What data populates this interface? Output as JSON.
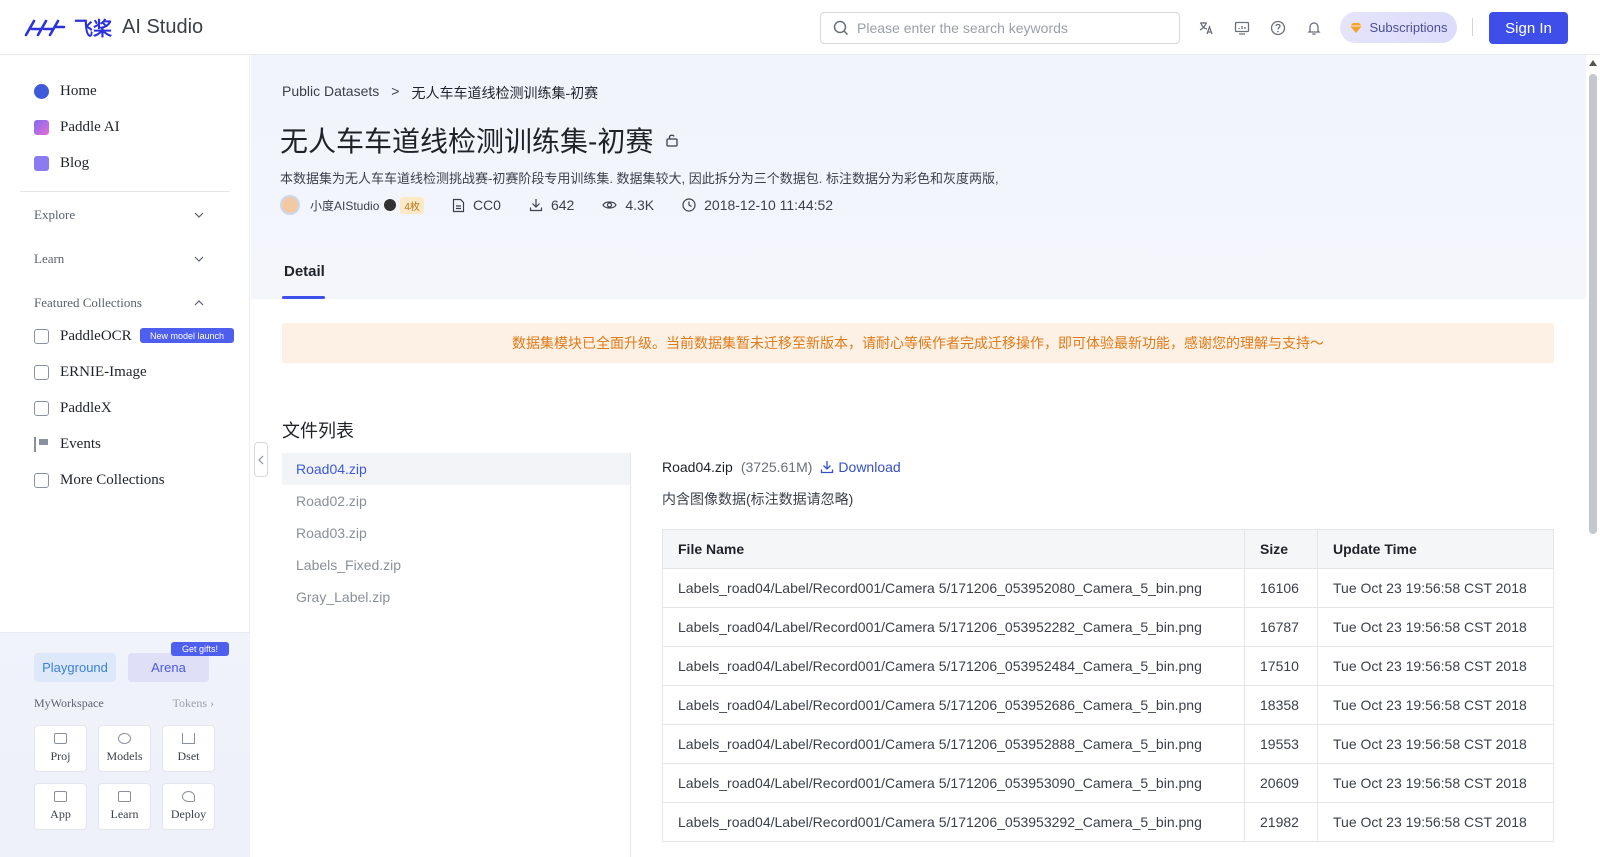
{
  "header": {
    "logo_cn": "飞桨",
    "logo_en": "AI Studio",
    "search_placeholder": "Please enter the search keywords",
    "subscriptions": "Subscriptions",
    "sign_in": "Sign In"
  },
  "sidebar": {
    "items": [
      {
        "label": "Home",
        "icon": "home-icon"
      },
      {
        "label": "Paddle AI",
        "icon": "paddle-ai-icon"
      },
      {
        "label": "Blog",
        "icon": "blog-icon"
      }
    ],
    "sections": [
      {
        "label": "Explore",
        "expanded": false
      },
      {
        "label": "Learn",
        "expanded": false
      },
      {
        "label": "Featured Collections",
        "expanded": true
      }
    ],
    "collections": [
      {
        "label": "PaddleOCR",
        "badge": "New model launch"
      },
      {
        "label": "ERNIE-Image"
      },
      {
        "label": "PaddleX"
      },
      {
        "label": "Events"
      },
      {
        "label": "More Collections"
      }
    ],
    "workspace": {
      "playground": "Playground",
      "arena": "Arena",
      "gift_badge": "Get gifts!",
      "title": "MyWorkspace",
      "tokens": "Tokens",
      "tiles": [
        "Proj",
        "Models",
        "Dset",
        "App",
        "Learn",
        "Deploy"
      ]
    }
  },
  "main": {
    "breadcrumb": {
      "parent": "Public Datasets",
      "sep": ">",
      "current": "无人车车道线检测训练集-初赛"
    },
    "title": "无人车车道线检测训练集-初赛",
    "description": "本数据集为无人车车道线检测挑战赛-初赛阶段专用训练集. 数据集较大, 因此拆分为三个数据包. 标注数据分为彩色和灰度两版,",
    "meta": {
      "author": "小度AIStudio",
      "badge": "4枚",
      "license": "CC0",
      "downloads": "642",
      "views": "4.3K",
      "date": "2018-12-10 11:44:52"
    },
    "tab": "Detail",
    "notice": "数据集模块已全面升级。当前数据集暂未迁移至新版本，请耐心等候作者完成迁移操作，即可体验最新功能，感谢您的理解与支持～",
    "file_list_title": "文件列表",
    "files": [
      "Road04.zip",
      "Road02.zip",
      "Road03.zip",
      "Labels_Fixed.zip",
      "Gray_Label.zip"
    ],
    "selected": {
      "name": "Road04.zip",
      "size": "(3725.61M)",
      "download": "Download",
      "desc": "内含图像数据(标注数据请忽略)"
    },
    "table": {
      "headers": [
        "File Name",
        "Size",
        "Update Time"
      ],
      "rows": [
        [
          "Labels_road04/Label/Record001/Camera 5/171206_053952080_Camera_5_bin.png",
          "16106",
          "Tue Oct 23 19:56:58 CST 2018"
        ],
        [
          "Labels_road04/Label/Record001/Camera 5/171206_053952282_Camera_5_bin.png",
          "16787",
          "Tue Oct 23 19:56:58 CST 2018"
        ],
        [
          "Labels_road04/Label/Record001/Camera 5/171206_053952484_Camera_5_bin.png",
          "17510",
          "Tue Oct 23 19:56:58 CST 2018"
        ],
        [
          "Labels_road04/Label/Record001/Camera 5/171206_053952686_Camera_5_bin.png",
          "18358",
          "Tue Oct 23 19:56:58 CST 2018"
        ],
        [
          "Labels_road04/Label/Record001/Camera 5/171206_053952888_Camera_5_bin.png",
          "19553",
          "Tue Oct 23 19:56:58 CST 2018"
        ],
        [
          "Labels_road04/Label/Record001/Camera 5/171206_053953090_Camera_5_bin.png",
          "20609",
          "Tue Oct 23 19:56:58 CST 2018"
        ],
        [
          "Labels_road04/Label/Record001/Camera 5/171206_053953292_Camera_5_bin.png",
          "21982",
          "Tue Oct 23 19:56:58 CST 2018"
        ]
      ]
    }
  },
  "colors": {
    "accent": "#3d4fe8",
    "notice_text": "#e07a18",
    "notice_bg": "#fdf1e6"
  }
}
